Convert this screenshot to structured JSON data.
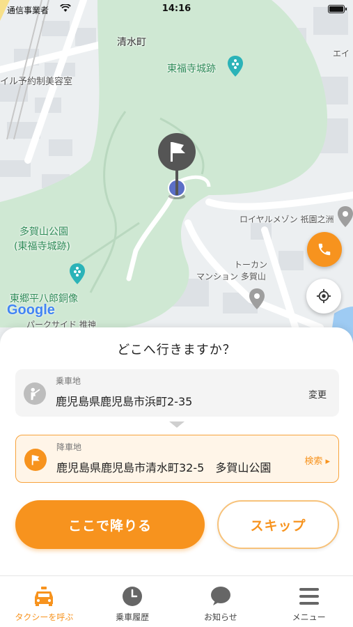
{
  "status_bar": {
    "carrier": "通信事業者",
    "time": "14:16"
  },
  "map": {
    "labels": {
      "town": "清水町",
      "castle_ruins": "東福寺城跡",
      "salon": "イル予約制美容室",
      "park_name": "多賀山公園",
      "park_sub": "(東福寺城跡)",
      "royal": "ロイヤルメゾン 祇園之洲",
      "tokan_1": "トーカン",
      "tokan_2": "マンション 多賀山",
      "statue": "東郷平八郎銅像",
      "parkside": "パークサイド 推神",
      "ei": "エイ"
    },
    "google_logo": "Google"
  },
  "sheet": {
    "title": "どこへ行きますか？",
    "pickup": {
      "kind": "乗車地",
      "address": "鹿児島県鹿児島市浜町2-35",
      "action": "変更"
    },
    "dropoff": {
      "kind": "降車地",
      "address": "鹿児島県鹿児島市清水町32-5　多賀山公園",
      "action": "検索 ▸"
    },
    "confirm_label": "ここで降りる",
    "skip_label": "スキップ"
  },
  "tabs": [
    {
      "label": "タクシーを呼ぶ",
      "icon": "taxi-icon",
      "active": true
    },
    {
      "label": "乗車履歴",
      "icon": "clock-icon",
      "active": false
    },
    {
      "label": "お知らせ",
      "icon": "speech-bubble-icon",
      "active": false
    },
    {
      "label": "メニュー",
      "icon": "menu-icon",
      "active": false
    }
  ],
  "colors": {
    "accent": "#f7931e",
    "park": "#cfe8d3",
    "road": "#ffffff"
  }
}
